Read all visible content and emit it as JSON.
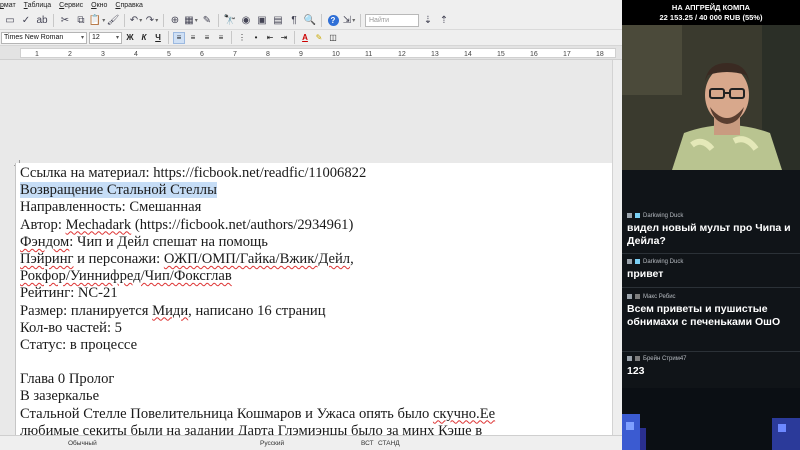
{
  "menu": [
    "рмат",
    "Таблица",
    "Сервис",
    "Окно",
    "Справка"
  ],
  "toolbar": {
    "find_placeholder": "Найти"
  },
  "format": {
    "font_name": "Times New Roman",
    "font_size": "12",
    "bold": "Ж",
    "italic": "К",
    "underline": "Ч",
    "font_color_letter": "A"
  },
  "ruler_numbers": [
    "1",
    "2",
    "3",
    "4",
    "5",
    "6",
    "7",
    "8",
    "9",
    "10",
    "11",
    "12",
    "13",
    "14",
    "15",
    "16",
    "17",
    "18"
  ],
  "document": {
    "lines": [
      "Ссылка на материал:  https://ficbook.net/readfic/11006822",
      "Возвращение Стальной Стеллы",
      "Направленность: Смешанная",
      "Автор: Mechadark (https://ficbook.net/authors/2934961)",
      "Фэндом: Чип и Дейл спешат на помощь",
      "Пэйринг и персонажи: ОЖП/ОМП/Гайка/Вжик/Дейл,",
      "Рокфор/Уиннифред/Чип/Фоксглав",
      "Рейтинг: NC-21",
      "Размер: планируется Миди, написано 16 страниц",
      "Кол-во частей: 5",
      "Статус: в процессе",
      "",
      "Глава 0 Пролог",
      "В зазеркалье",
      "Стальной Стелле Повелительница Кошмаров и Ужаса опять было скучно.Ее",
      "любимые секиты были на задании Дарта Глэмиэнцы было за минх Кэше в"
    ]
  },
  "status": {
    "style": "Обычный",
    "language": "Русский",
    "insert": "ВСТ",
    "select_mode": "СТАНД"
  },
  "stream": {
    "goal_title": "НА АПГРЕЙД КОМПА",
    "goal_progress": "22 153.25 / 40 000 RUB (55%)",
    "goal_fraction": 0.55
  },
  "chat": [
    {
      "user": "Darkwing Duck",
      "text": "видел новый мульт про Чипа и Дейла?"
    },
    {
      "user": "Darkwing Duck",
      "text": "привет"
    },
    {
      "user": "Макс Ребис",
      "text": "Всем приветы и пушистые обнимахи с печеньками ОшО"
    },
    {
      "user": "Брейн Стрим47",
      "text": "123"
    }
  ],
  "colors": {
    "selection": "#c6ddf6",
    "chat_bg": "#101418",
    "ice_badge": "#7bd0f5"
  }
}
